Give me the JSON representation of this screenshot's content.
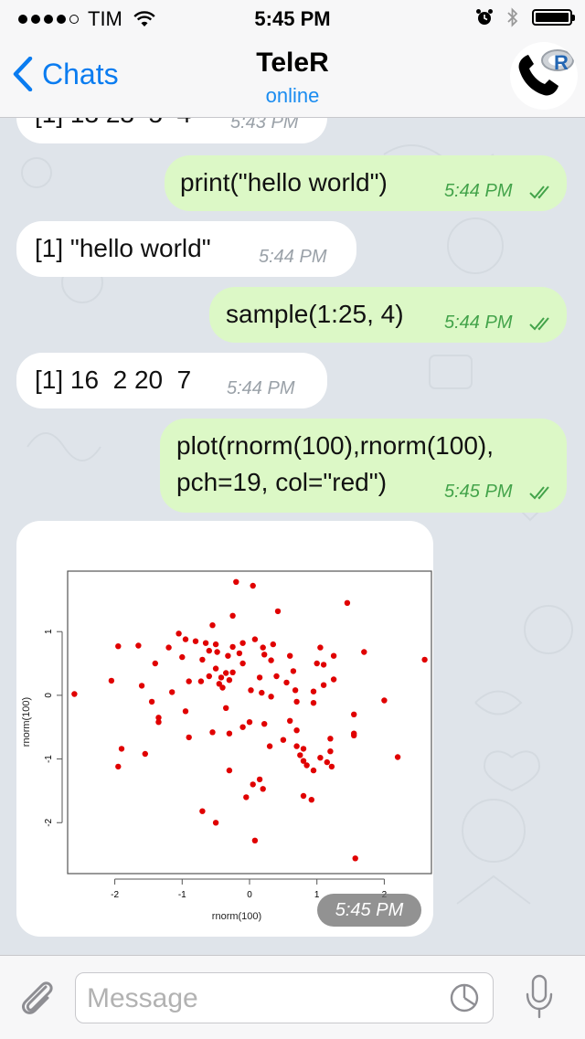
{
  "status_bar": {
    "carrier": "TIM",
    "time": "5:45 PM",
    "icons": [
      "signal-dots-icon",
      "wifi-icon",
      "alarm-icon",
      "bluetooth-icon",
      "battery-icon"
    ]
  },
  "nav": {
    "back_label": "Chats",
    "title": "TeleR",
    "status": "online",
    "avatar_icon": "r-phone-logo-icon"
  },
  "messages": [
    {
      "dir": "in",
      "text": "[1] 13 23  5  4",
      "time": "5:43 PM"
    },
    {
      "dir": "out",
      "text": "print(\"hello world\")",
      "time": "5:44 PM"
    },
    {
      "dir": "in",
      "text": "[1] \"hello world\"",
      "time": "5:44 PM"
    },
    {
      "dir": "out",
      "text": "sample(1:25, 4)",
      "time": "5:44 PM"
    },
    {
      "dir": "in",
      "text": "[1] 16  2 20  7",
      "time": "5:44 PM"
    },
    {
      "dir": "out",
      "line1": "plot(rnorm(100),rnorm(100),",
      "line2": "pch=19, col=\"red\")",
      "time": "5:45 PM"
    }
  ],
  "image_message": {
    "time": "5:45 PM",
    "chart_data": {
      "type": "scatter",
      "xlabel": "rnorm(100)",
      "ylabel": "rnorm(100)",
      "xlim": [
        -2.7,
        2.7
      ],
      "ylim": [
        -2.8,
        1.95
      ],
      "xticks": [
        "-2",
        "-1",
        "0",
        "1",
        "2"
      ],
      "yticks": [
        "-2",
        "-1",
        "0",
        "1"
      ],
      "point_color": "#e00000",
      "points": [
        [
          -0.2,
          1.78
        ],
        [
          0.05,
          1.72
        ],
        [
          1.45,
          1.45
        ],
        [
          0.42,
          1.32
        ],
        [
          -0.25,
          1.25
        ],
        [
          -0.55,
          1.1
        ],
        [
          -1.05,
          0.97
        ],
        [
          -0.95,
          0.88
        ],
        [
          -0.8,
          0.85
        ],
        [
          -0.65,
          0.82
        ],
        [
          -0.5,
          0.8
        ],
        [
          -0.1,
          0.82
        ],
        [
          0.08,
          0.88
        ],
        [
          0.35,
          0.8
        ],
        [
          -1.65,
          0.78
        ],
        [
          -1.2,
          0.75
        ],
        [
          -0.6,
          0.7
        ],
        [
          -0.48,
          0.68
        ],
        [
          -0.25,
          0.76
        ],
        [
          0.2,
          0.75
        ],
        [
          -1.95,
          0.77
        ],
        [
          1.05,
          0.75
        ],
        [
          1.7,
          0.68
        ],
        [
          0.22,
          0.64
        ],
        [
          -0.15,
          0.66
        ],
        [
          -0.32,
          0.62
        ],
        [
          0.6,
          0.62
        ],
        [
          1.25,
          0.62
        ],
        [
          2.6,
          0.56
        ],
        [
          -1.0,
          0.6
        ],
        [
          -0.7,
          0.56
        ],
        [
          -0.1,
          0.5
        ],
        [
          0.32,
          0.55
        ],
        [
          -1.4,
          0.5
        ],
        [
          1.0,
          0.5
        ],
        [
          1.1,
          0.48
        ],
        [
          -0.5,
          0.42
        ],
        [
          -0.35,
          0.35
        ],
        [
          0.65,
          0.38
        ],
        [
          -0.6,
          0.3
        ],
        [
          -0.42,
          0.28
        ],
        [
          -0.3,
          0.24
        ],
        [
          -0.25,
          0.36
        ],
        [
          -0.72,
          0.22
        ],
        [
          -0.9,
          0.22
        ],
        [
          0.15,
          0.28
        ],
        [
          0.4,
          0.3
        ],
        [
          0.55,
          0.2
        ],
        [
          1.25,
          0.25
        ],
        [
          -2.05,
          0.23
        ],
        [
          -0.45,
          0.18
        ],
        [
          -0.4,
          0.12
        ],
        [
          0.02,
          0.08
        ],
        [
          1.1,
          0.16
        ],
        [
          -1.6,
          0.15
        ],
        [
          -1.15,
          0.05
        ],
        [
          -2.6,
          0.02
        ],
        [
          0.18,
          0.04
        ],
        [
          0.68,
          0.08
        ],
        [
          0.95,
          0.06
        ],
        [
          0.32,
          -0.02
        ],
        [
          0.7,
          -0.1
        ],
        [
          -1.45,
          -0.1
        ],
        [
          0.95,
          -0.12
        ],
        [
          2.0,
          -0.08
        ],
        [
          -0.35,
          -0.2
        ],
        [
          -0.95,
          -0.25
        ],
        [
          1.55,
          -0.3
        ],
        [
          -1.35,
          -0.35
        ],
        [
          -1.35,
          -0.42
        ],
        [
          0.0,
          -0.42
        ],
        [
          0.22,
          -0.45
        ],
        [
          0.6,
          -0.4
        ],
        [
          -0.1,
          -0.5
        ],
        [
          0.7,
          -0.55
        ],
        [
          1.55,
          -0.6
        ],
        [
          -0.55,
          -0.58
        ],
        [
          -0.3,
          -0.6
        ],
        [
          1.55,
          -0.63
        ],
        [
          0.5,
          -0.7
        ],
        [
          1.2,
          -0.68
        ],
        [
          -0.9,
          -0.66
        ],
        [
          0.7,
          -0.8
        ],
        [
          0.8,
          -0.84
        ],
        [
          1.2,
          -0.88
        ],
        [
          -1.55,
          -0.92
        ],
        [
          0.3,
          -0.8
        ],
        [
          -1.9,
          -0.84
        ],
        [
          1.05,
          -0.98
        ],
        [
          0.75,
          -0.94
        ],
        [
          2.2,
          -0.97
        ],
        [
          0.8,
          -1.03
        ],
        [
          1.15,
          -1.05
        ],
        [
          -1.95,
          -1.12
        ],
        [
          0.85,
          -1.1
        ],
        [
          1.22,
          -1.12
        ],
        [
          0.95,
          -1.18
        ],
        [
          -0.3,
          -1.18
        ],
        [
          0.15,
          -1.32
        ],
        [
          0.05,
          -1.4
        ],
        [
          0.2,
          -1.47
        ],
        [
          -0.05,
          -1.6
        ],
        [
          0.8,
          -1.58
        ],
        [
          0.92,
          -1.64
        ],
        [
          -0.7,
          -1.82
        ],
        [
          -0.5,
          -2.0
        ],
        [
          0.08,
          -2.28
        ],
        [
          1.57,
          -2.56
        ]
      ]
    }
  },
  "input_bar": {
    "placeholder": "Message",
    "attach_icon": "paperclip-icon",
    "sticker_icon": "sticker-icon",
    "mic_icon": "microphone-icon"
  }
}
